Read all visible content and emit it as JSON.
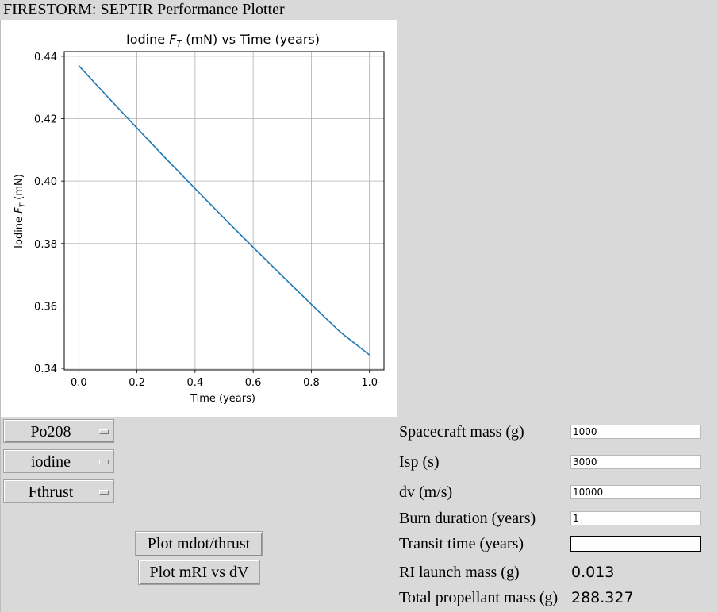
{
  "window": {
    "title": "FIRESTORM: SEPTIR Performance Plotter"
  },
  "chart_data": {
    "type": "line",
    "title_prefix": "Iodine ",
    "title_var": "F",
    "title_sub": "T",
    "title_suffix": " (mN) vs Time (years)",
    "xlabel": "Time (years)",
    "ylabel_prefix": "Iodine ",
    "ylabel_var": "F",
    "ylabel_sub": "T",
    "ylabel_suffix": " (mN)",
    "xlim": [
      -0.05,
      1.05
    ],
    "ylim": [
      0.3395,
      0.4415
    ],
    "xticks": [
      0.0,
      0.2,
      0.4,
      0.6,
      0.8,
      1.0
    ],
    "xtick_labels": [
      "0.0",
      "0.2",
      "0.4",
      "0.6",
      "0.8",
      "1.0"
    ],
    "yticks": [
      0.34,
      0.36,
      0.38,
      0.4,
      0.42,
      0.44
    ],
    "ytick_labels": [
      "0.34",
      "0.36",
      "0.38",
      "0.40",
      "0.42",
      "0.44"
    ],
    "grid": true,
    "line_color": "#1f77b4",
    "series": [
      {
        "x": [
          0.0,
          0.1,
          0.2,
          0.3,
          0.4,
          0.5,
          0.6,
          0.7,
          0.8,
          0.9,
          1.0
        ],
        "values": [
          0.437,
          0.4269,
          0.417,
          0.4072,
          0.3976,
          0.3881,
          0.3788,
          0.3696,
          0.3605,
          0.3516,
          0.3443
        ]
      }
    ]
  },
  "controls": {
    "menu_isotope": "Po208",
    "menu_propellant": "iodine",
    "menu_quantity": "Fthrust",
    "btn_plot_mdot": "Plot mdot/thrust",
    "btn_plot_mri": "Plot mRI vs dV"
  },
  "inputs": {
    "spacecraft_mass": {
      "label": "Spacecraft mass (g)",
      "value": "1000"
    },
    "isp": {
      "label": "Isp (s)",
      "value": "3000"
    },
    "dv": {
      "label": "dv (m/s)",
      "value": "10000"
    },
    "burn_duration": {
      "label": "Burn duration (years)",
      "value": "1"
    },
    "transit_time": {
      "label": "Transit time (years)",
      "value": ""
    }
  },
  "outputs": {
    "ri_launch_mass": {
      "label": "RI launch mass (g)",
      "value": "0.013"
    },
    "total_propellant_mass": {
      "label": "Total propellant mass (g)",
      "value": "288.327"
    }
  }
}
